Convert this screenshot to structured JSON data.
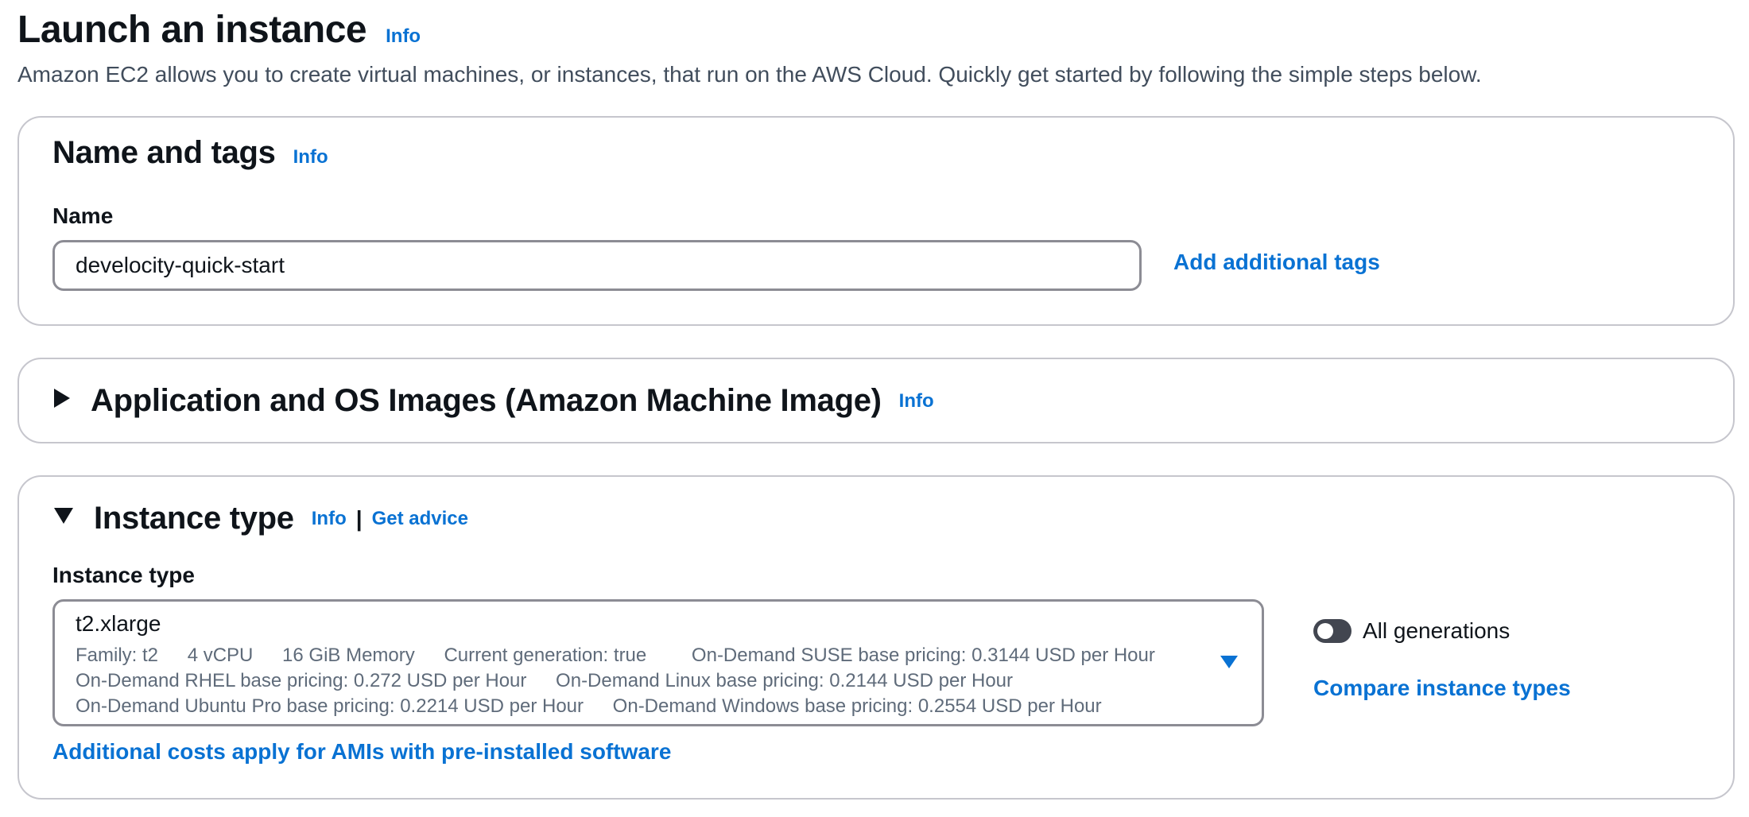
{
  "header": {
    "title": "Launch an instance",
    "info": "Info",
    "description": "Amazon EC2 allows you to create virtual machines, or instances, that run on the AWS Cloud. Quickly get started by following the simple steps below."
  },
  "name_and_tags": {
    "title": "Name and tags",
    "info": "Info",
    "name_label": "Name",
    "name_value": "develocity-quick-start",
    "add_tags_link": "Add additional tags"
  },
  "ami": {
    "title": "Application and OS Images (Amazon Machine Image)",
    "info": "Info",
    "expanded": false
  },
  "instance_type": {
    "title": "Instance type",
    "info": "Info",
    "separator": "|",
    "get_advice": "Get advice",
    "field_label": "Instance type",
    "selected": "t2.xlarge",
    "details": {
      "family": "Family: t2",
      "vcpu": "4 vCPU",
      "memory": "16 GiB Memory",
      "current_generation": "Current generation: true",
      "suse_pricing": "On-Demand SUSE base pricing: 0.3144 USD per Hour",
      "rhel_pricing": "On-Demand RHEL base pricing: 0.272 USD per Hour",
      "linux_pricing": "On-Demand Linux base pricing: 0.2144 USD per Hour",
      "ubuntu_pro_pricing": "On-Demand Ubuntu Pro base pricing: 0.2214 USD per Hour",
      "windows_pricing": "On-Demand Windows base pricing: 0.2554 USD per Hour"
    },
    "all_generations_label": "All generations",
    "all_generations_on": false,
    "compare_link": "Compare instance types",
    "costs_link": "Additional costs apply for AMIs with pre-installed software"
  },
  "colors": {
    "link": "#0972d3",
    "text": "#0f141a",
    "secondary_text": "#5f6b7a",
    "border": "#c6c6cd",
    "input_border": "#8c8c94",
    "toggle_off": "#424650"
  },
  "icons": {
    "collapsed_caret": "caret-right-icon",
    "expanded_caret": "caret-down-icon",
    "select_caret": "caret-down-filled-icon"
  }
}
